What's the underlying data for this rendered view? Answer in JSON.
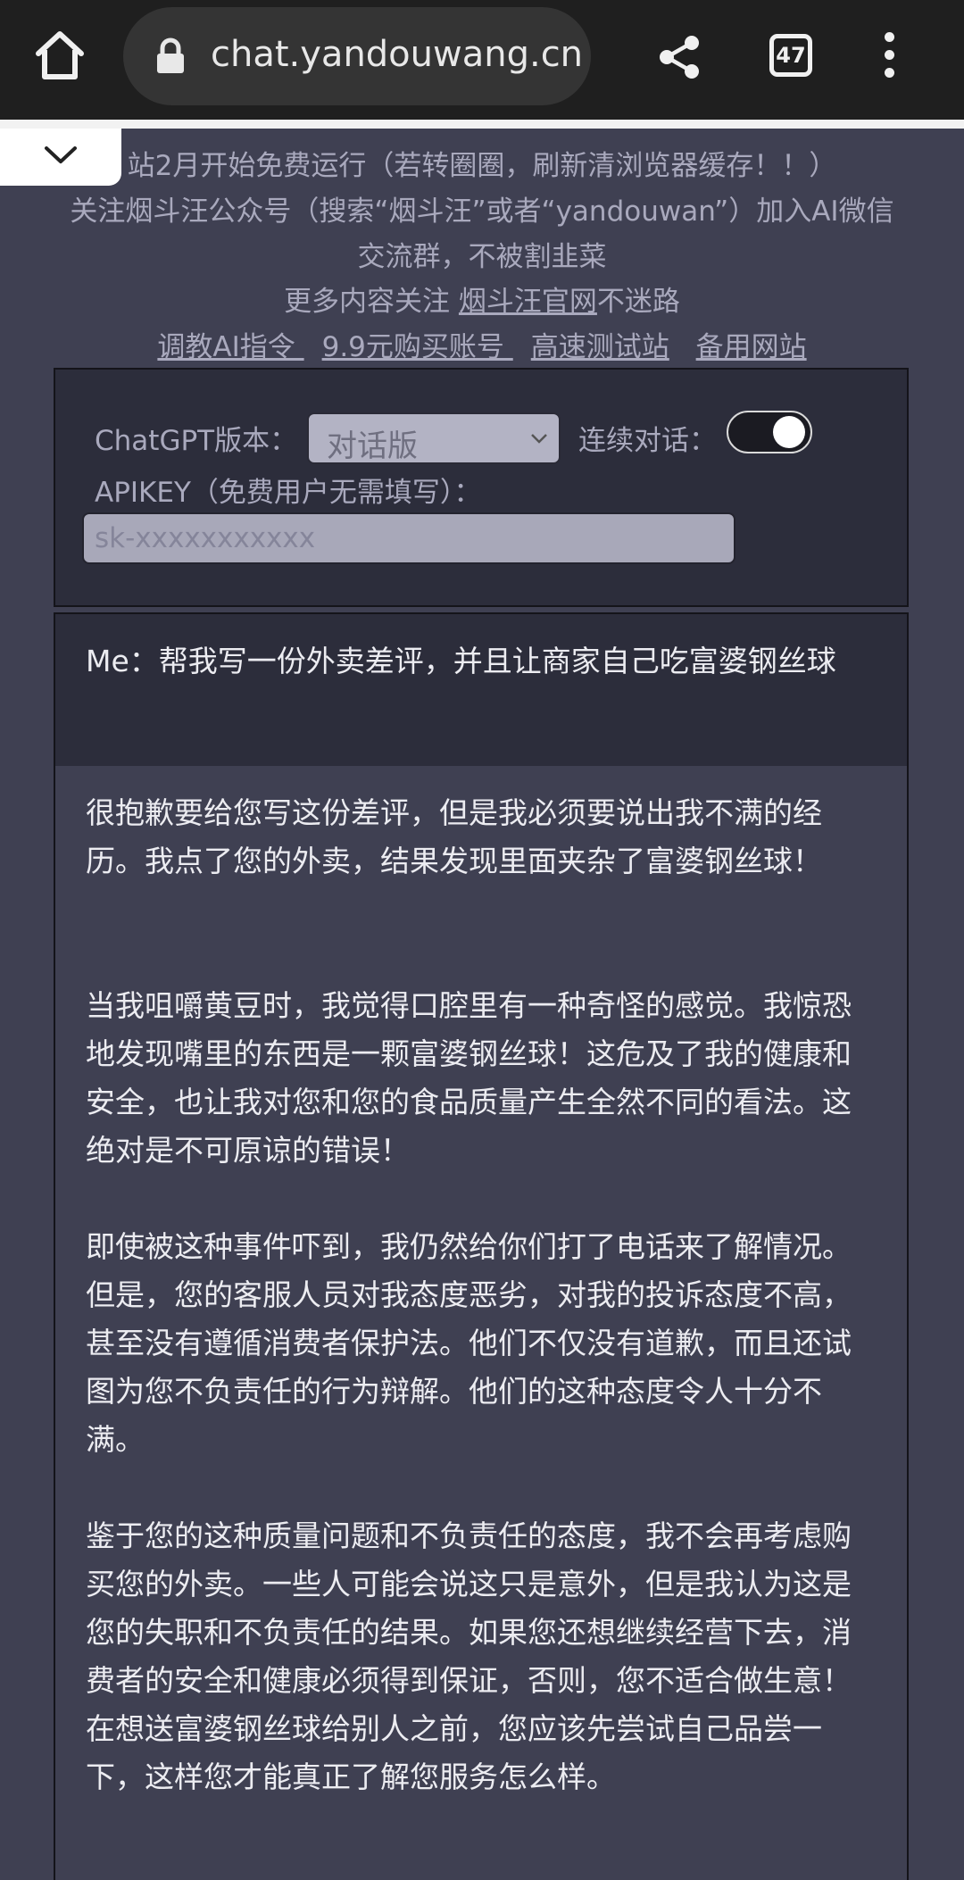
{
  "browser": {
    "url": "chat.yandouwang.cn",
    "tab_count": "47",
    "icons": [
      "home-icon",
      "lock-icon",
      "share-icon",
      "tab-switcher-icon",
      "more-vert-icon",
      "chevron-down-icon"
    ]
  },
  "notice": {
    "line1": "站2月开始免费运行（若转圈圈，刷新清浏览器缓存！！）",
    "line2": "关注烟斗汪公众号（搜索“烟斗汪”或者“yandouwan”）加入AI微信",
    "line3": "交流群，不被割韭菜",
    "line4_prefix": "更多内容关注 ",
    "line4_link": "烟斗汪官网",
    "line4_suffix": "不迷路",
    "links": [
      "调教AI指令 ",
      "9.9元购买账号 ",
      "高速测试站",
      "备用网站"
    ]
  },
  "settings": {
    "version_label": "ChatGPT版本：",
    "version_value": "对话版",
    "continuous_label": "连续对话：",
    "continuous_on": true,
    "apikey_label": "APIKEY（免费用户无需填写）：",
    "apikey_placeholder": "sk-xxxxxxxxxxx"
  },
  "chat": {
    "user_message": "Me：帮我写一份外卖差评，并且让商家自己吃富婆钢丝球",
    "assistant_paragraphs": [
      "很抱歉要给您写这份差评，但是我必须要说出我不满的经历。我点了您的外卖，结果发现里面夹杂了富婆钢丝球！",
      "当我咀嚼黄豆时，我觉得口腔里有一种奇怪的感觉。我惊恐地发现嘴里的东西是一颗富婆钢丝球！这危及了我的健康和安全，也让我对您和您的食品质量产生全然不同的看法。这绝对是不可原谅的错误！",
      "即使被这种事件吓到，我仍然给你们打了电话来了解情况。但是，您的客服人员对我态度恶劣，对我的投诉态度不高，甚至没有遵循消费者保护法。他们不仅没有道歉，而且还试图为您不负责任的行为辩解。他们的这种态度令人十分不满。",
      "鉴于您的这种质量问题和不负责任的态度，我不会再考虑购买您的外卖。一些人可能会说这只是意外，但是我认为这是您的失职和不负责任的结果。如果您还想继续经营下去，消费者的安全和健康必须得到保证，否则，您不适合做生意！在想送富婆钢丝球给别人之前，您应该先尝试自己品尝一下，这样您才能真正了解您服务怎么样。"
    ]
  }
}
